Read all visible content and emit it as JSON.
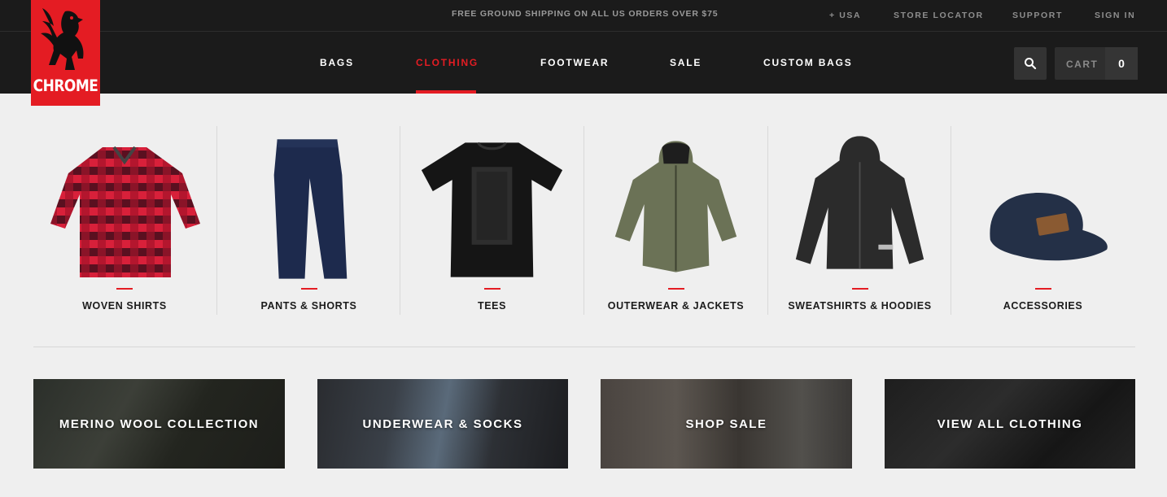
{
  "brand": {
    "name": "CHROME"
  },
  "topbar": {
    "promo": "FREE GROUND SHIPPING ON ALL US ORDERS OVER $75",
    "links": [
      "+ USA",
      "STORE LOCATOR",
      "SUPPORT",
      "SIGN IN"
    ]
  },
  "nav": {
    "items": [
      "BAGS",
      "CLOTHING",
      "FOOTWEAR",
      "SALE",
      "CUSTOM BAGS"
    ],
    "active": "CLOTHING"
  },
  "cart": {
    "label": "CART",
    "count": "0"
  },
  "icons": {
    "search": "search-icon",
    "logo": "griffin-logo-icon"
  },
  "categories": [
    {
      "label": "WOVEN SHIRTS",
      "icon": "woven-shirt-icon"
    },
    {
      "label": "PANTS & SHORTS",
      "icon": "pants-icon"
    },
    {
      "label": "TEES",
      "icon": "tee-icon"
    },
    {
      "label": "OUTERWEAR & JACKETS",
      "icon": "jacket-icon"
    },
    {
      "label": "SWEATSHIRTS & HOODIES",
      "icon": "hoodie-icon"
    },
    {
      "label": "ACCESSORIES",
      "icon": "cap-icon"
    }
  ],
  "tiles": [
    {
      "label": "MERINO WOOL COLLECTION"
    },
    {
      "label": "UNDERWEAR & SOCKS"
    },
    {
      "label": "SHOP SALE"
    },
    {
      "label": "VIEW ALL CLOTHING"
    }
  ],
  "colors": {
    "accent": "#e41c23",
    "header_bg": "#1b1b1b",
    "page_bg": "#efefef"
  }
}
